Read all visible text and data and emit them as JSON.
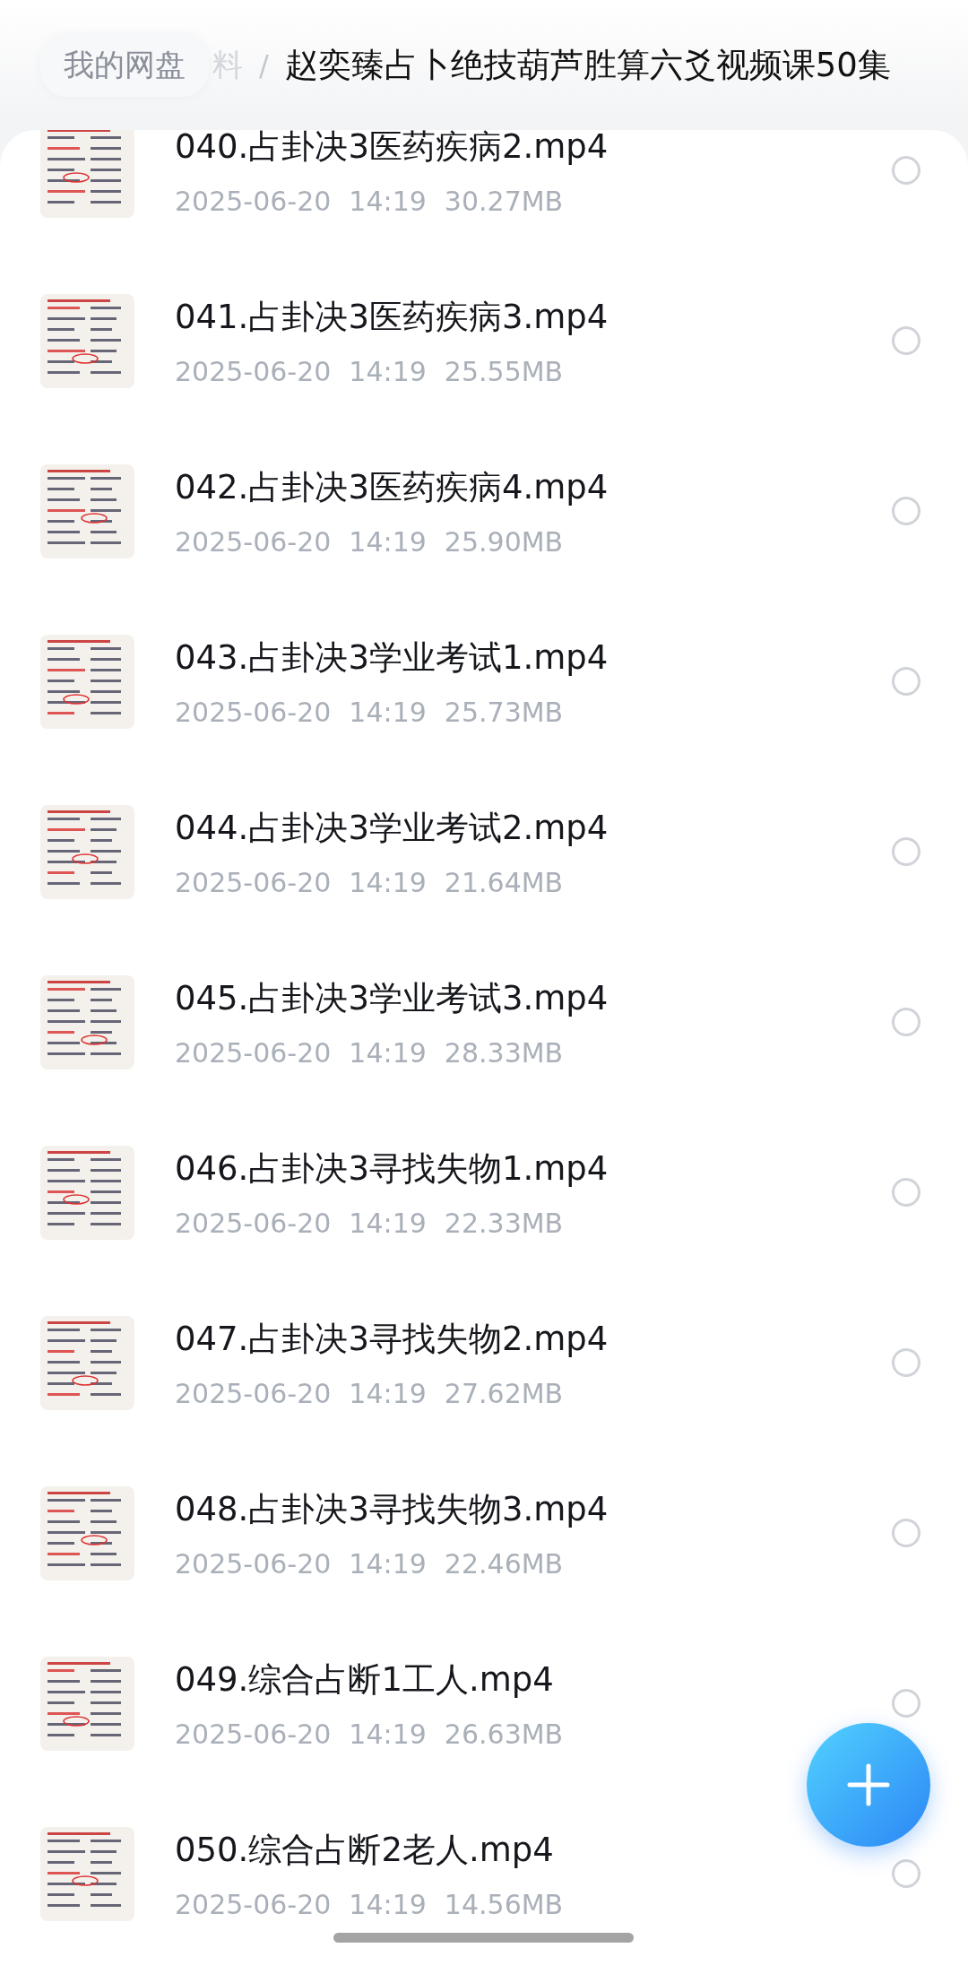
{
  "breadcrumb": {
    "root": "我的网盘",
    "hidden_crumb": "料",
    "separator": "/",
    "current": "赵奕臻占卜绝技葫芦胜算六爻视频课50集"
  },
  "files": [
    {
      "name": "040.占卦决3医药疾病2.mp4",
      "date": "2025-06-20",
      "time": "14:19",
      "size": "30.27MB",
      "selected": false
    },
    {
      "name": "041.占卦决3医药疾病3.mp4",
      "date": "2025-06-20",
      "time": "14:19",
      "size": "25.55MB",
      "selected": false
    },
    {
      "name": "042.占卦决3医药疾病4.mp4",
      "date": "2025-06-20",
      "time": "14:19",
      "size": "25.90MB",
      "selected": false
    },
    {
      "name": "043.占卦决3学业考试1.mp4",
      "date": "2025-06-20",
      "time": "14:19",
      "size": "25.73MB",
      "selected": false
    },
    {
      "name": "044.占卦决3学业考试2.mp4",
      "date": "2025-06-20",
      "time": "14:19",
      "size": "21.64MB",
      "selected": false
    },
    {
      "name": "045.占卦决3学业考试3.mp4",
      "date": "2025-06-20",
      "time": "14:19",
      "size": "28.33MB",
      "selected": false
    },
    {
      "name": "046.占卦决3寻找失物1.mp4",
      "date": "2025-06-20",
      "time": "14:19",
      "size": "22.33MB",
      "selected": false
    },
    {
      "name": "047.占卦决3寻找失物2.mp4",
      "date": "2025-06-20",
      "time": "14:19",
      "size": "27.62MB",
      "selected": false
    },
    {
      "name": "048.占卦决3寻找失物3.mp4",
      "date": "2025-06-20",
      "time": "14:19",
      "size": "22.46MB",
      "selected": false
    },
    {
      "name": "049.综合占断1工人.mp4",
      "date": "2025-06-20",
      "time": "14:19",
      "size": "26.63MB",
      "selected": false
    },
    {
      "name": "050.综合占断2老人.mp4",
      "date": "2025-06-20",
      "time": "14:19",
      "size": "14.56MB",
      "selected": false
    }
  ]
}
